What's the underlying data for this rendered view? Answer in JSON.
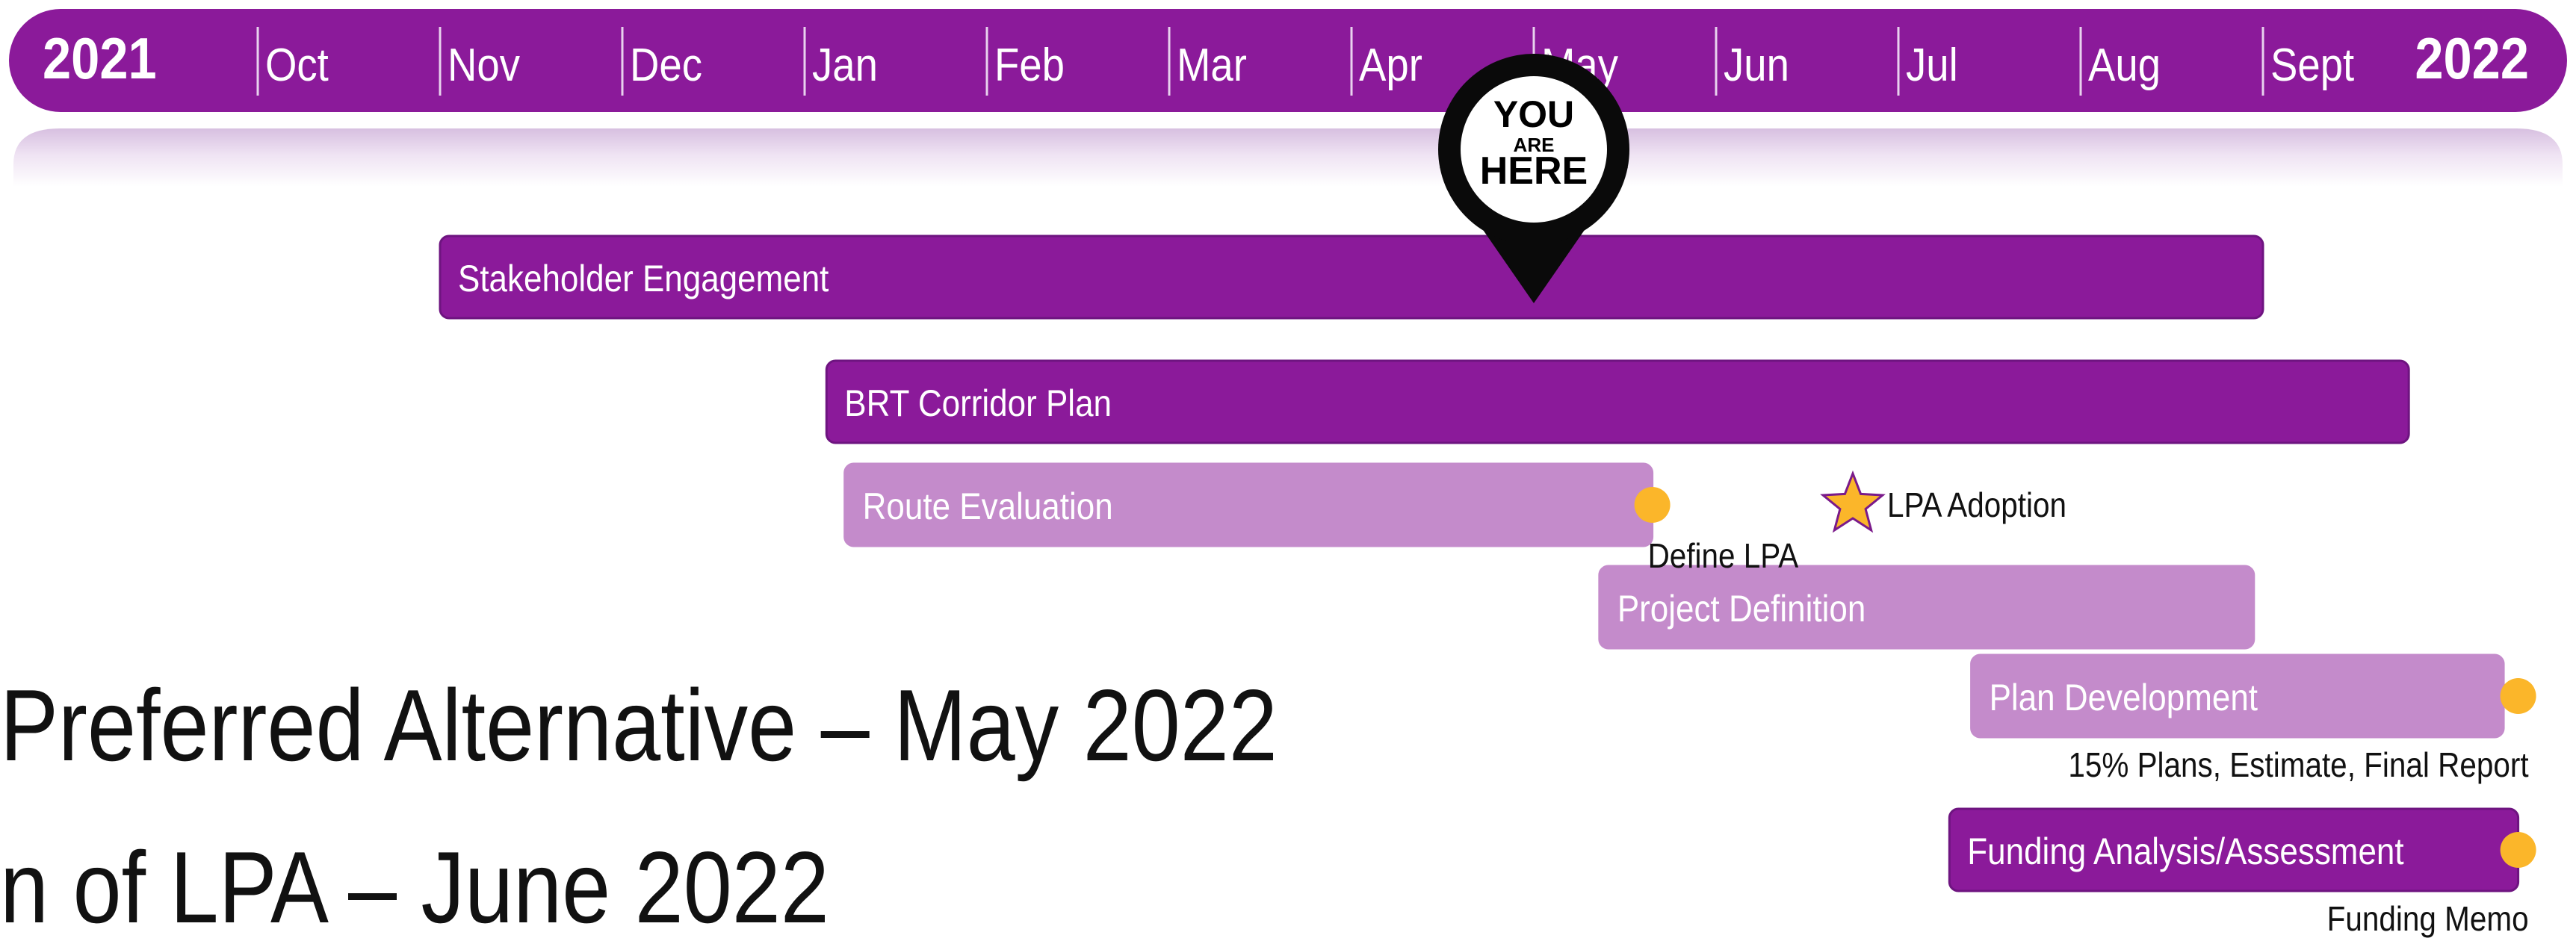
{
  "timeline": {
    "start_year": "2021",
    "end_year": "2022",
    "months": [
      "Oct",
      "Nov",
      "Dec",
      "Jan",
      "Feb",
      "Mar",
      "Apr",
      "May",
      "Jun",
      "Jul",
      "Aug",
      "Sept"
    ]
  },
  "marker": {
    "line1": "YOU",
    "line2": "ARE",
    "line3": "HERE",
    "position_month": 7.0
  },
  "tasks": [
    {
      "label": "Stakeholder Engagement",
      "start_month": 1.0,
      "end_month": 11.0,
      "style": "dark"
    },
    {
      "label": "BRT Corridor Plan",
      "start_month": 3.12,
      "end_month": 11.8,
      "style": "dark"
    },
    {
      "label": "Route Evaluation",
      "start_month": 3.22,
      "end_month": 7.65,
      "style": "light"
    },
    {
      "label": "Project Definition",
      "start_month": 7.36,
      "end_month": 10.95,
      "style": "light"
    },
    {
      "label": "Plan Development",
      "start_month": 9.4,
      "end_month": 12.32,
      "style": "light"
    },
    {
      "label": "Funding Analysis/Assessment",
      "start_month": 9.28,
      "end_month": 12.4,
      "style": "dark"
    }
  ],
  "milestones": [
    {
      "type": "dot",
      "label": "Define LPA",
      "month": 7.65,
      "row": 2
    },
    {
      "type": "star",
      "label": "LPA Adoption",
      "month": 8.75,
      "row": 2
    },
    {
      "type": "dot",
      "label": "15% Plans, Estimate, Final Report",
      "month": 12.4,
      "row": 4
    },
    {
      "type": "dot",
      "label": "Funding Memo",
      "month": 12.4,
      "row": 5
    }
  ],
  "body_text": [
    "Preferred Alternative – May 2022",
    "n of LPA – June 2022"
  ],
  "colors": {
    "dark_purple": "#8B1A9A",
    "light_purple": "#C48BCB",
    "milestone_orange": "#FBB62A",
    "star_stroke": "#7A1A8A",
    "marker_black": "#0A0A0A"
  }
}
